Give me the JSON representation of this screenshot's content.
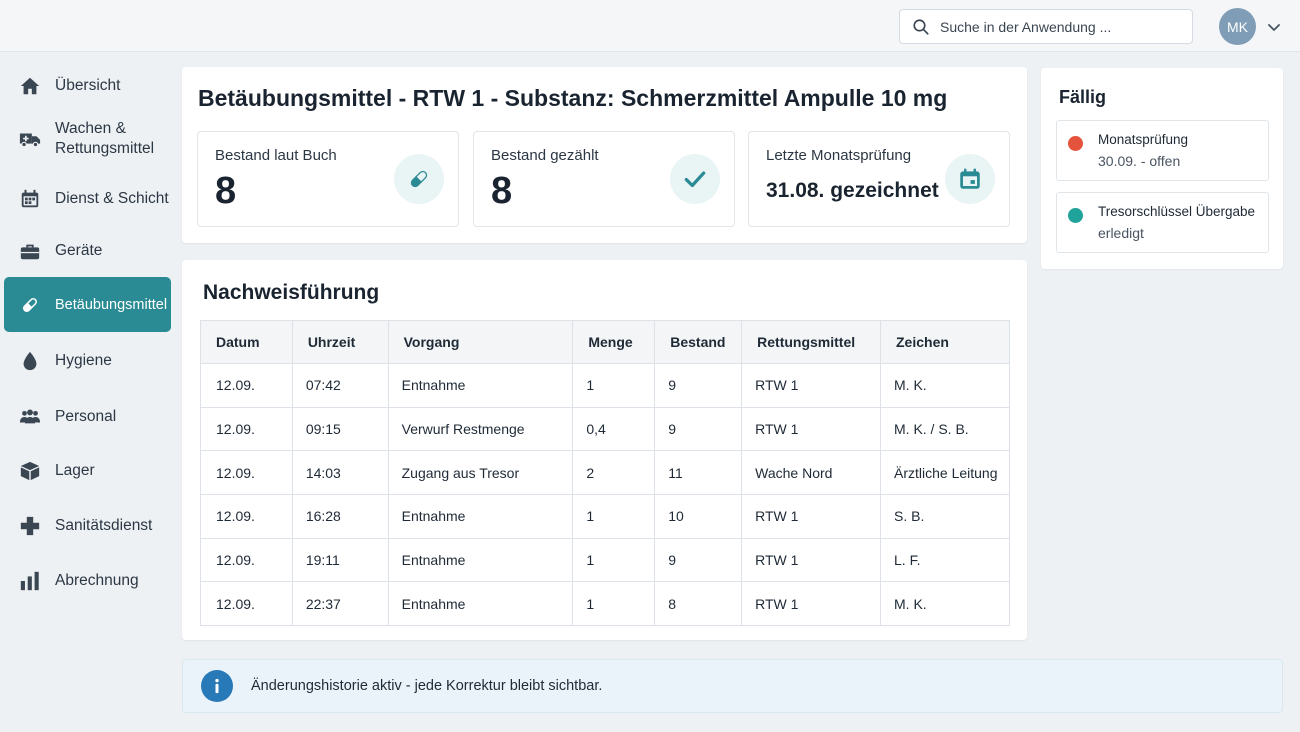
{
  "header": {
    "search_placeholder": "Suche in der Anwendung ...",
    "user_initials": "MK"
  },
  "sidebar": {
    "items": [
      {
        "label": "Übersicht",
        "icon": "home-icon"
      },
      {
        "label": "Wachen &\nRettungsmittel",
        "icon": "ambulance-icon"
      },
      {
        "label": "Dienst & Schicht",
        "icon": "calendar-icon"
      },
      {
        "label": "Geräte",
        "icon": "briefcase-icon"
      },
      {
        "label": "Betäubungsmittel",
        "icon": "pill-icon",
        "active": true
      },
      {
        "label": "Hygiene",
        "icon": "drop-icon"
      },
      {
        "label": "Personal",
        "icon": "people-icon"
      },
      {
        "label": "Lager",
        "icon": "box-icon"
      },
      {
        "label": "Sanitätsdienst",
        "icon": "cross-icon"
      },
      {
        "label": "Abrechnung",
        "icon": "bar-chart-icon"
      }
    ]
  },
  "main": {
    "title": "Betäubungsmittel - RTW 1 - Substanz: Schmerzmittel Ampulle 10 mg",
    "stats": [
      {
        "label": "Bestand laut Buch",
        "value": "8",
        "icon": "pill-icon"
      },
      {
        "label": "Bestand gezählt",
        "value": "8",
        "icon": "check-icon"
      },
      {
        "label": "Letzte Monatsprüfung",
        "value": "31.08. gezeichnet",
        "icon": "calendar-icon"
      }
    ]
  },
  "log": {
    "title": "Nachweisführung",
    "columns": [
      "Datum",
      "Uhrzeit",
      "Vorgang",
      "Menge",
      "Bestand",
      "Rettungsmittel",
      "Zeichen"
    ],
    "rows": [
      [
        "12.09.",
        "07:42",
        "Entnahme",
        "1",
        "9",
        "RTW 1",
        "M. K."
      ],
      [
        "12.09.",
        "09:15",
        "Verwurf Restmenge",
        "0,4",
        "9",
        "RTW 1",
        "M. K. / S. B."
      ],
      [
        "12.09.",
        "14:03",
        "Zugang aus Tresor",
        "2",
        "11",
        "Wache Nord",
        "Ärztliche Leitung"
      ],
      [
        "12.09.",
        "16:28",
        "Entnahme",
        "1",
        "10",
        "RTW 1",
        "S. B."
      ],
      [
        "12.09.",
        "19:11",
        "Entnahme",
        "1",
        "9",
        "RTW 1",
        "L. F."
      ],
      [
        "12.09.",
        "22:37",
        "Entnahme",
        "1",
        "8",
        "RTW 1",
        "M. K."
      ]
    ]
  },
  "due": {
    "title": "Fällig",
    "items": [
      {
        "title": "Monatsprüfung",
        "status": "30.09. - offen",
        "color": "#e5533d"
      },
      {
        "title": "Tresorschlüssel Übergabe",
        "status": "erledigt",
        "color": "#1fa39a"
      }
    ]
  },
  "info": {
    "text": "Änderungshistorie aktiv - jede Korrektur bleibt sichtbar."
  },
  "colors": {
    "accent": "#2a8b94",
    "info": "#2879b8",
    "open": "#e5533d",
    "done": "#1fa39a"
  }
}
